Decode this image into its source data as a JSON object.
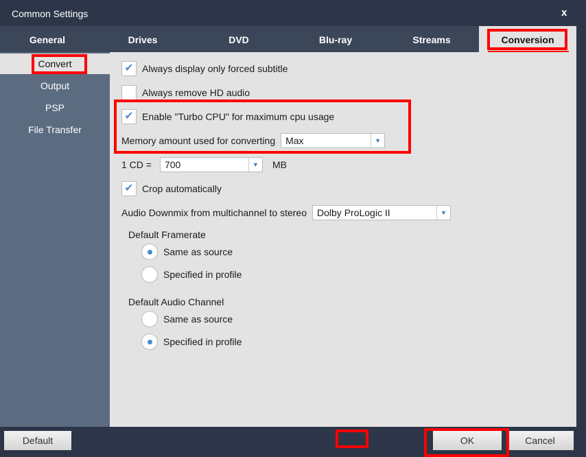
{
  "window": {
    "title": "Common Settings",
    "close": "x"
  },
  "tabs": [
    {
      "label": "General"
    },
    {
      "label": "Drives"
    },
    {
      "label": "DVD"
    },
    {
      "label": "Blu-ray"
    },
    {
      "label": "Streams"
    },
    {
      "label": "Conversion"
    }
  ],
  "sidebar": [
    {
      "label": "Convert"
    },
    {
      "label": "Output"
    },
    {
      "label": "PSP"
    },
    {
      "label": "File Transfer"
    }
  ],
  "options": {
    "forced_subtitle": {
      "label": "Always display only forced subtitle",
      "checked": true
    },
    "remove_hd_audio": {
      "label": "Always remove HD audio",
      "checked": false
    },
    "turbo_cpu": {
      "label": "Enable \"Turbo CPU\" for maximum cpu usage",
      "checked": true
    },
    "memory": {
      "label": "Memory amount used for converting",
      "value": "Max"
    },
    "cd": {
      "label": "1 CD =",
      "value": "700",
      "unit": "MB"
    },
    "crop": {
      "label": "Crop automatically",
      "checked": true
    },
    "downmix": {
      "label": "Audio Downmix from multichannel to stereo",
      "value": "Dolby ProLogic II"
    },
    "framerate": {
      "label": "Default Framerate",
      "opt1": "Same as source",
      "opt2": "Specified in profile",
      "selected": "Same as source"
    },
    "audio_channel": {
      "label": "Default Audio Channel",
      "opt1": "Same as source",
      "opt2": "Specified in profile",
      "selected": "Specified in profile"
    }
  },
  "buttons": {
    "default": "Default",
    "ok": "OK",
    "cancel": "Cancel"
  },
  "icons": {
    "check": "✔",
    "arrow": "▼"
  }
}
